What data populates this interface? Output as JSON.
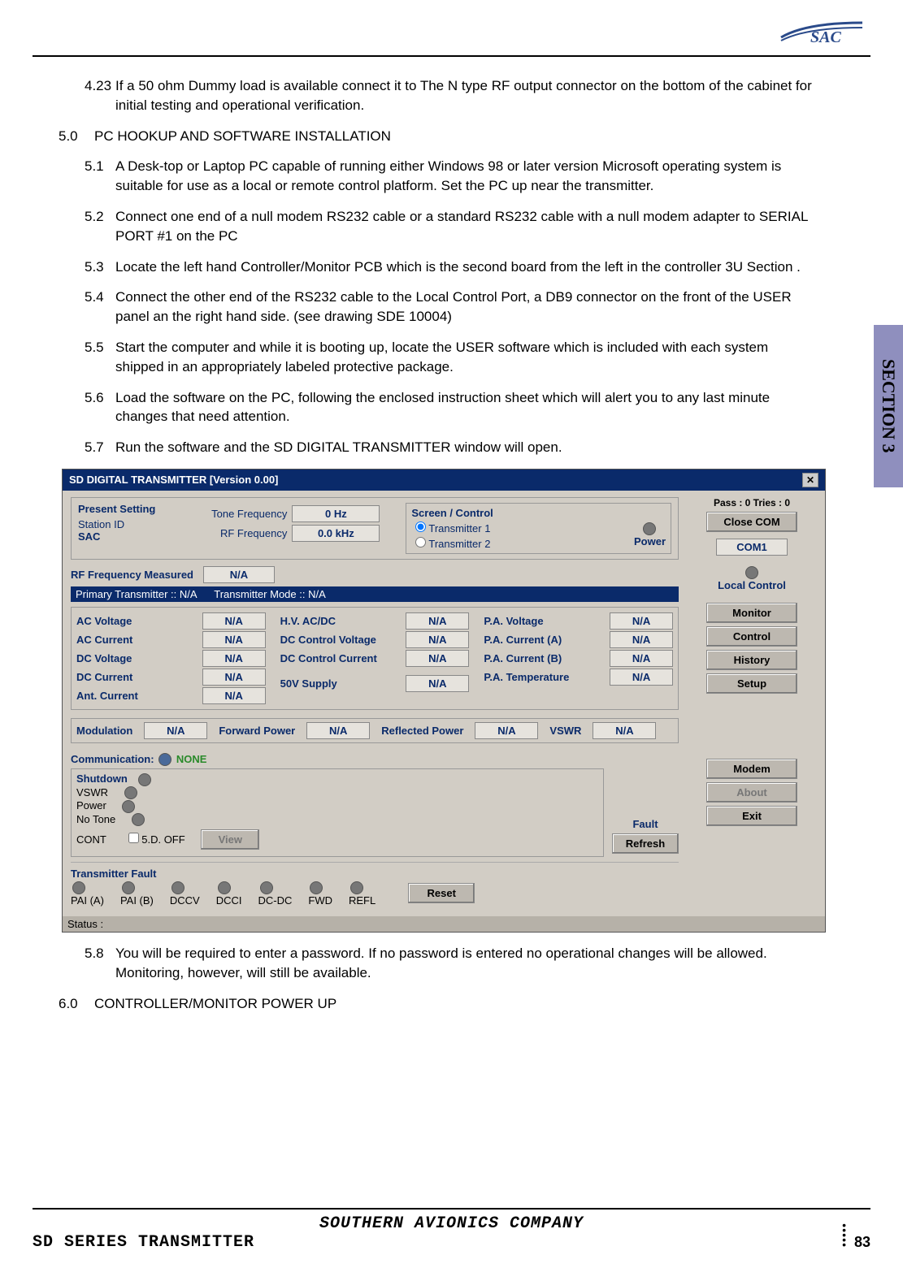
{
  "logo_text": "SAC",
  "section_tab": "SECTION 3",
  "paragraphs": [
    {
      "num": "4.23",
      "text": "If a 50 ohm Dummy load is available connect it to The N type RF output connector on the bottom of the cabinet for initial testing and operational verification."
    },
    {
      "num": "5.0",
      "text": "PC HOOKUP AND SOFTWARE  INSTALLATION",
      "head": true
    },
    {
      "num": "5.1",
      "text": "A Desk-top or Laptop PC capable of running either Windows 98 or later version Microsoft operating system is suitable for use as a local or remote control platform. Set the PC up near the transmitter."
    },
    {
      "num": "5.2",
      "text": " Connect one end of a null modem RS232 cable or a standard RS232 cable with a null modem adapter to  SERIAL PORT #1 on the PC"
    },
    {
      "num": "5.3",
      "text": "Locate the left hand Controller/Monitor PCB which is the second board from the left in the controller 3U  Section ."
    },
    {
      "num": "5.4",
      "text": "Connect the other end of the RS232 cable  to the Local Control Port, a DB9 connector on the front of the USER panel an the right hand side. (see drawing SDE 10004)"
    },
    {
      "num": "5.5",
      "text": " Start the computer and while it is booting up, locate the USER software which is included with each system shipped in an appropriately labeled protective package."
    },
    {
      "num": "5.6",
      "text": "Load the software on the PC, following the enclosed instruction sheet which will alert you to any last minute changes that need attention."
    },
    {
      "num": "5.7",
      "text": "Run the software and the SD DIGITAL TRANSMITTER  window will open."
    },
    {
      "num": "5.8",
      "text": "You will be required to enter a password. If no password is entered no operational changes will be allowed. Monitoring, however, will still be available.",
      "after_shot": true
    },
    {
      "num": "6.0",
      "text": "CONTROLLER/MONITOR POWER UP",
      "head": true,
      "after_shot": true
    }
  ],
  "window": {
    "title": "SD DIGITAL TRANSMITTER   [Version 0.00]",
    "present_setting": "Present Setting",
    "station_id_lbl": "Station ID",
    "station_id_val": "SAC",
    "tone_freq_lbl": "Tone Frequency",
    "tone_freq_val": "0 Hz",
    "rf_freq_lbl": "RF Frequency",
    "rf_freq_val": "0.0 kHz",
    "screen_control": "Screen / Control",
    "tx1": "Transmitter 1",
    "tx2": "Transmitter 2",
    "power": "Power",
    "rf_measured_lbl": "RF Frequency Measured",
    "rf_measured_val": "N/A",
    "primary_tx": "Primary Transmitter :: N/A",
    "tx_mode": "Transmitter Mode :: N/A",
    "col1_ac_v": "AC Voltage",
    "col1_ac_c": "AC Current",
    "col1_dc_v": "DC Voltage",
    "col1_dc_c": "DC Current",
    "col1_ant": "Ant. Current",
    "col2_hv": "H.V. AC/DC",
    "col2_dcv": "DC Control Voltage",
    "col2_dcc": "DC Control Current",
    "col2_50v": "50V Supply",
    "col3_pa_v": "P.A. Voltage",
    "col3_pa_a": "P.A. Current (A)",
    "col3_pa_b": "P.A. Current (B)",
    "col3_pa_t": "P.A. Temperature",
    "na": "N/A",
    "modulation": "Modulation",
    "fwd_pwr": "Forward Power",
    "refl_pwr": "Reflected Power",
    "vswr": "VSWR",
    "comm": "Communication:",
    "comm_val": "NONE",
    "shutdown": "Shutdown",
    "sd_vswr": "VSWR",
    "sd_power": "Power",
    "sd_notone": "No Tone",
    "sd_cont": "CONT",
    "sd_off": "5.D. OFF",
    "sd_view": "View",
    "fault": "Fault",
    "refresh": "Refresh",
    "txfault": "Transmitter Fault",
    "tf": [
      "PAI (A)",
      "PAI (B)",
      "DCCV",
      "DCCI",
      "DC-DC",
      "FWD",
      "REFL"
    ],
    "reset": "Reset",
    "pass_tries": "Pass : 0   Tries : 0",
    "close_com": "Close COM",
    "com_sel": "COM1",
    "local_control": "Local Control",
    "btns": [
      "Monitor",
      "Control",
      "History",
      "Setup"
    ],
    "modem": "Modem",
    "about": "About",
    "exit": "Exit",
    "status": "Status :"
  },
  "footer": {
    "company": "SOUTHERN AVIONICS COMPANY",
    "series": "SD SERIES TRANSMITTER",
    "page": "83"
  }
}
